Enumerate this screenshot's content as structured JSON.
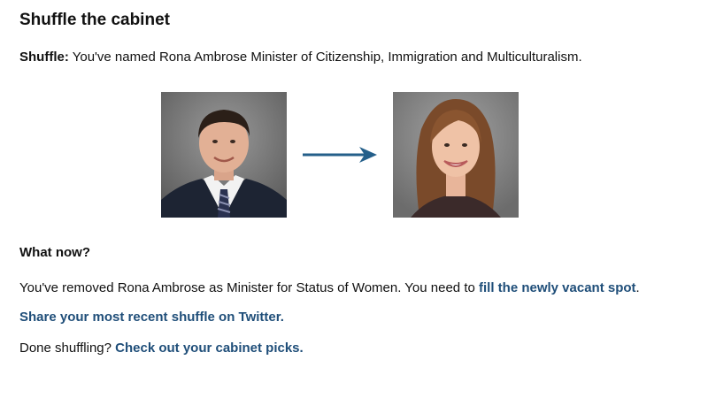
{
  "title": "Shuffle the cabinet",
  "shuffle": {
    "label": "Shuffle:",
    "text": "You've named Rona Ambrose Minister of Citizenship, Immigration and Multiculturalism."
  },
  "photos": {
    "old_icon": "man-in-suit-portrait",
    "new_icon": "woman-portrait",
    "arrow_icon": "arrow-right",
    "arrow_color": "#245f8a"
  },
  "what_now": {
    "heading": "What now?",
    "removed_text": "You've removed Rona Ambrose as Minister for Status of Women. You need to ",
    "fill_link": "fill the newly vacant spot",
    "period": ".",
    "share_link": "Share your most recent shuffle on Twitter.",
    "done_text": "Done shuffling? ",
    "picks_link": "Check out your cabinet picks."
  },
  "colors": {
    "link": "#1f4e79",
    "text": "#111111"
  }
}
